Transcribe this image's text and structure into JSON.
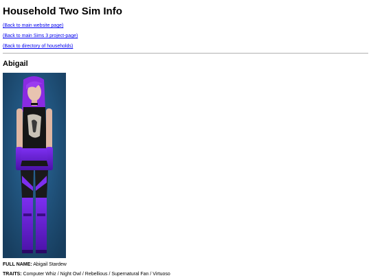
{
  "page": {
    "title": "Household Two Sim Info"
  },
  "nav": {
    "links": [
      {
        "label": "(Back to main website page)"
      },
      {
        "label": "(Back to main Sims 3 project-page)"
      },
      {
        "label": "(Back to directory of households)"
      }
    ]
  },
  "sim": {
    "name_heading": "Abigail",
    "full_name_label": "FULL NAME:",
    "full_name": "Abigail Stardew",
    "traits_label": "TRAITS:",
    "traits": "Computer Whiz / Night Owl / Rebellious / Supernatural Fan / Virtuoso"
  },
  "colors": {
    "link": "#0000ee",
    "portrait_background": "#1f4f78",
    "hair": "#8a2be2",
    "outfit_accent": "#6a1fd1"
  },
  "icons": {
    "portrait": "sim-portrait-image"
  }
}
